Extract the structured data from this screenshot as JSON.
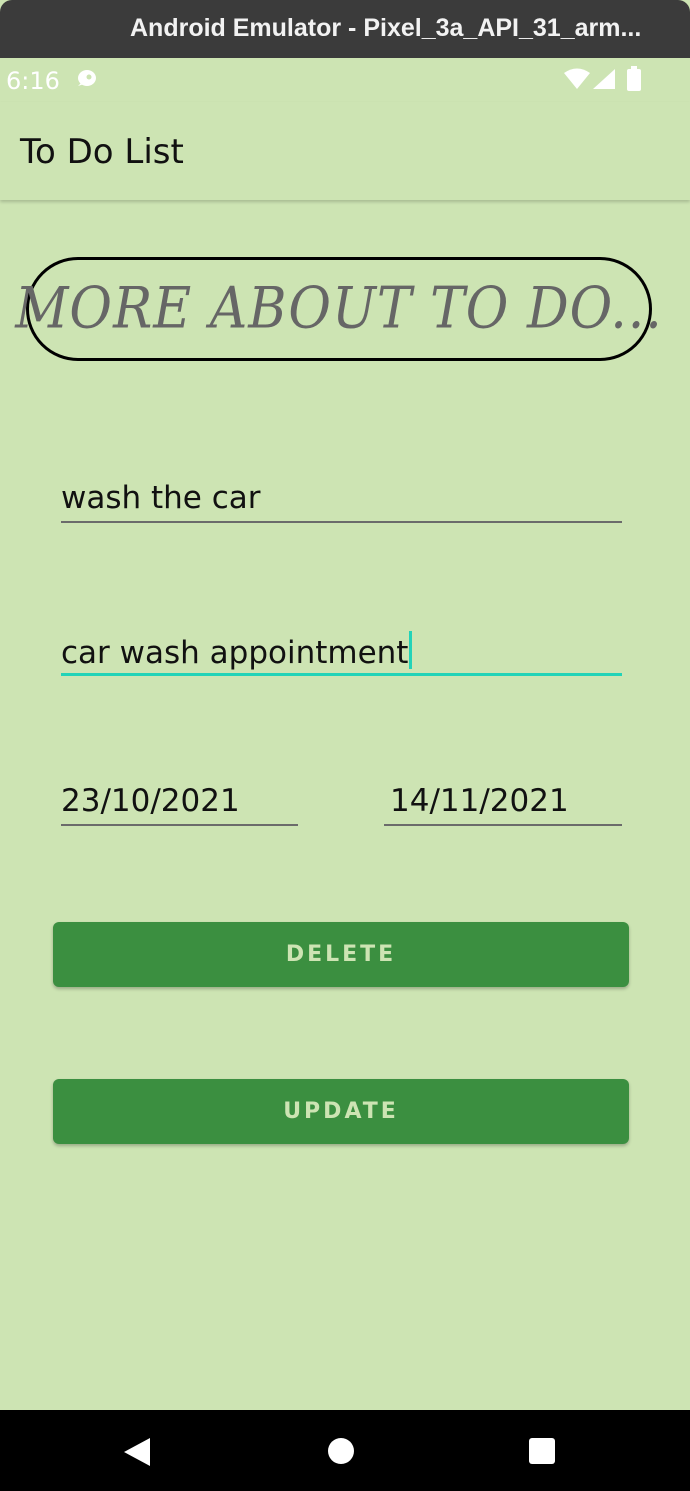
{
  "window": {
    "title": "Android Emulator - Pixel_3a_API_31_arm..."
  },
  "status_bar": {
    "time": "6:16",
    "icons": [
      "notification-icon",
      "wifi-icon",
      "signal-icon",
      "battery-icon"
    ]
  },
  "app_bar": {
    "title": "To Do List"
  },
  "banner": {
    "text": "MORE ABOUT TO DO..."
  },
  "form": {
    "title_value": "wash the car",
    "description_value": "car wash appointment",
    "start_date": "23/10/2021",
    "end_date": "14/11/2021"
  },
  "buttons": {
    "delete_label": "DELETE",
    "update_label": "UPDATE"
  },
  "nav_bar": {
    "icons": [
      "back-icon",
      "home-icon",
      "recents-icon"
    ]
  },
  "colors": {
    "background": "#cde4b3",
    "button": "#3b8f40",
    "focus_accent": "#22d3b8"
  }
}
